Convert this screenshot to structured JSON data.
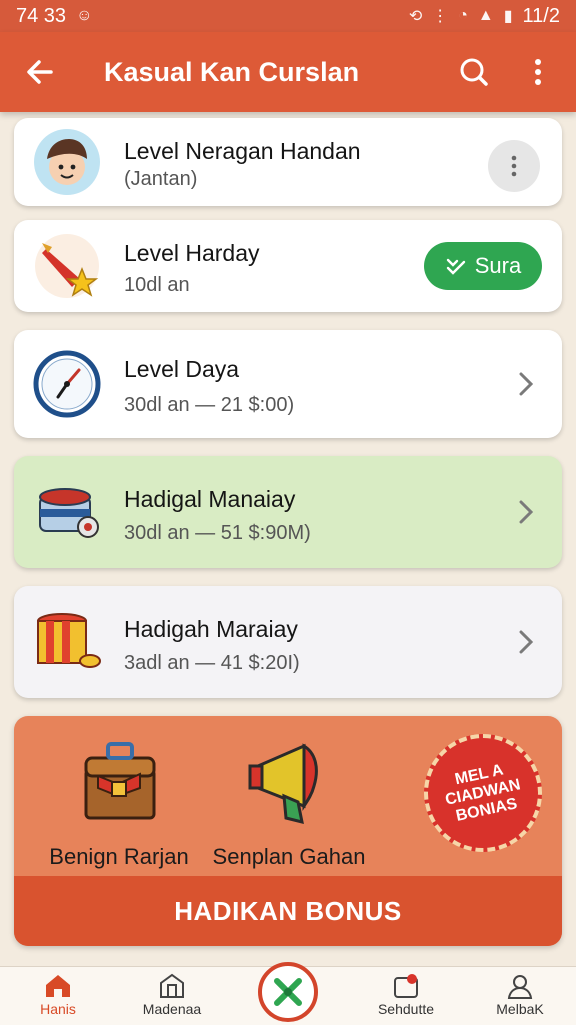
{
  "statusbar": {
    "time": "74 33",
    "right_text": "11/2"
  },
  "appbar": {
    "title": "Kasual Kan Curslan"
  },
  "items": [
    {
      "title": "Level Neragan Handan",
      "subtitle": "(Jantan)"
    },
    {
      "title": "Level Harday",
      "subtitle": "10dl an",
      "action_label": "Sura"
    },
    {
      "title": "Level Daya",
      "subtitle": "30dl an — 21 $:00)"
    },
    {
      "title": "Hadigal Manaiay",
      "subtitle": "30dl an — 51 $:90M)"
    },
    {
      "title": "Hadigah Maraiay",
      "subtitle": "3adl an — 41 $:20I)"
    }
  ],
  "bonus": {
    "left_label": "Benign Rarjan",
    "mid_label": "Senplan Gahan",
    "badge_lines": [
      "MEL A",
      "CIADWAN",
      "BONIAS"
    ],
    "button_label": "HADIKAN BONUS"
  },
  "bottomnav": [
    {
      "label": "Hanis"
    },
    {
      "label": "Madenaa"
    },
    {
      "label": "Sehdutte"
    },
    {
      "label": "MelbaK"
    }
  ],
  "colors": {
    "primary": "#dd5a37",
    "green": "#2fa651",
    "highlight_card": "#d9ecc4",
    "bonus_bg": "#e7835a"
  }
}
